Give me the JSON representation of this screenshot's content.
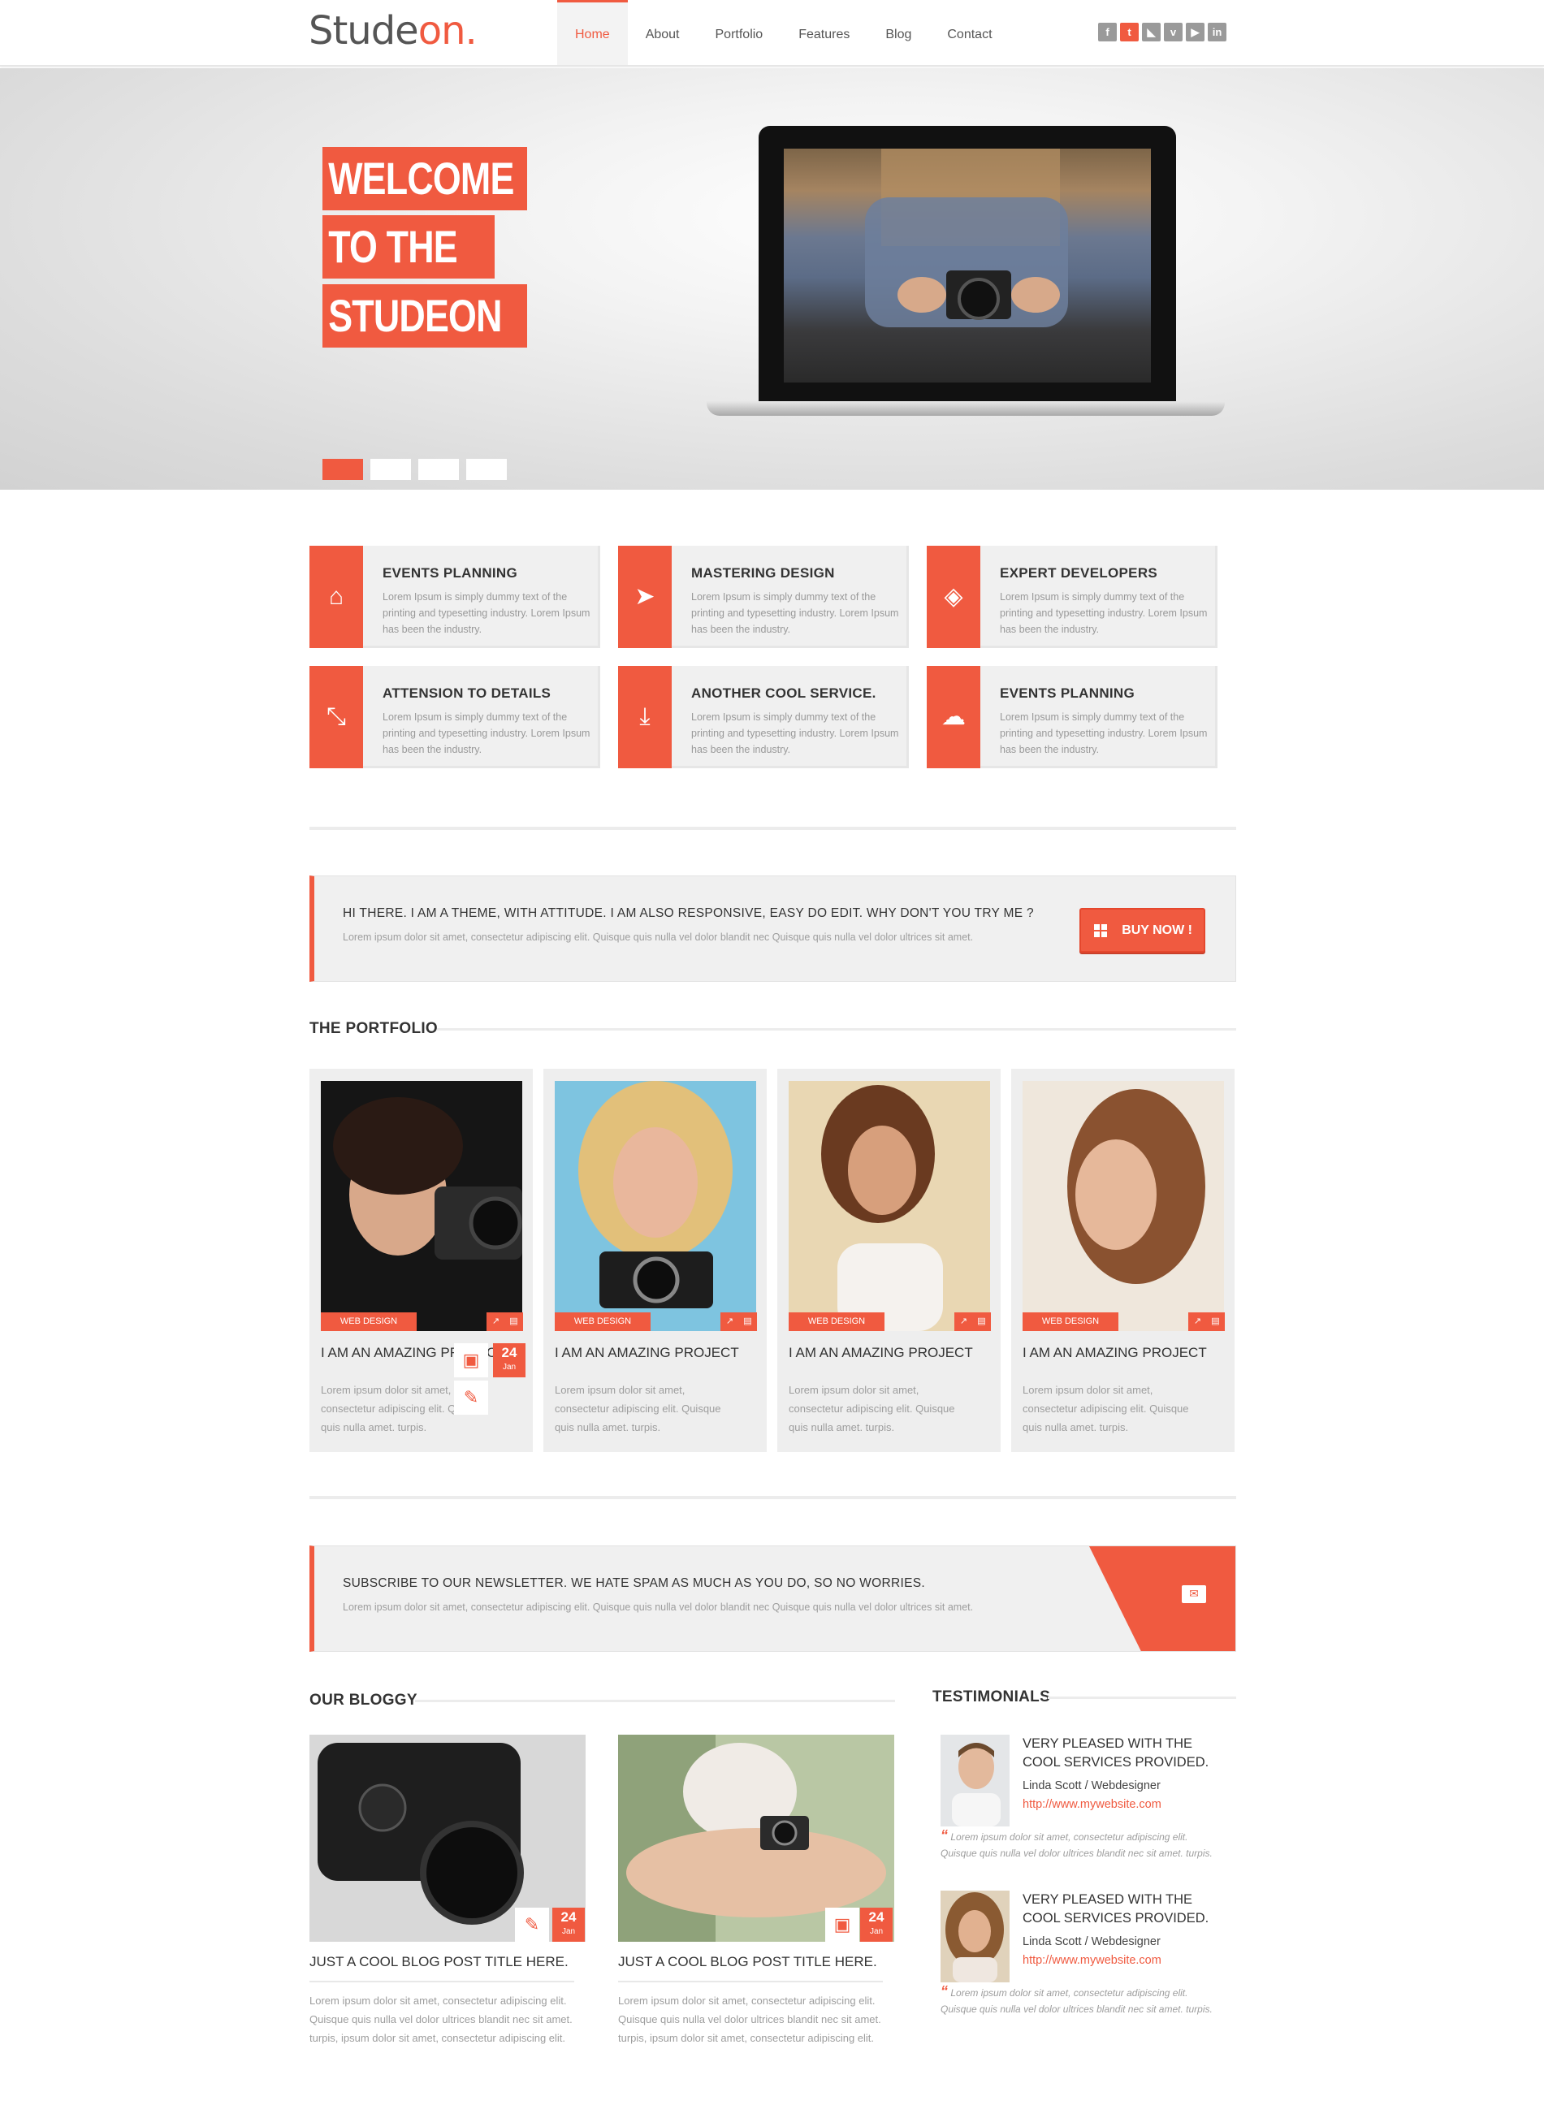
{
  "header": {
    "logo_main": "Stude",
    "logo_accent": "on.",
    "nav": [
      "Home",
      "About",
      "Portfolio",
      "Features",
      "Blog",
      "Contact"
    ],
    "social_icons": [
      "facebook-icon",
      "twitter-icon",
      "rss-icon",
      "vimeo-icon",
      "youtube-icon",
      "linkedin-icon"
    ]
  },
  "hero": {
    "lines": [
      "WELCOME",
      "TO THE",
      "STUDEON"
    ],
    "slides": 4,
    "active_slide": 1
  },
  "services": [
    {
      "title": "EVENTS PLANNING",
      "text": "Lorem Ipsum is simply dummy text of the printing and typesetting industry. Lorem Ipsum has been the industry.",
      "icon": "rocket-icon"
    },
    {
      "title": "MASTERING DESIGN",
      "text": "Lorem Ipsum is simply dummy text of the printing and typesetting industry. Lorem Ipsum has been the industry.",
      "icon": "paper-plane-icon"
    },
    {
      "title": "EXPERT DEVELOPERS",
      "text": "Lorem Ipsum is simply dummy text of the printing and typesetting industry. Lorem Ipsum has been the industry.",
      "icon": "layers-icon"
    },
    {
      "title": "ATTENSION TO DETAILS",
      "text": "Lorem Ipsum is simply dummy text of the printing and typesetting industry. Lorem Ipsum has been the industry.",
      "icon": "arrows-in-icon"
    },
    {
      "title": "ANOTHER COOL SERVICE.",
      "text": "Lorem Ipsum is simply dummy text of the printing and typesetting industry. Lorem Ipsum has been the industry.",
      "icon": "download-icon"
    },
    {
      "title": "EVENTS PLANNING",
      "text": "Lorem Ipsum is simply dummy text of the printing and typesetting industry. Lorem Ipsum has been the industry.",
      "icon": "cloud-icon"
    }
  ],
  "callout": {
    "title": "HI THERE. I AM A THEME, WITH ATTITUDE. I AM ALSO RESPONSIVE, EASY DO EDIT. WHY DON'T YOU TRY ME ?",
    "text": "Lorem ipsum dolor sit amet, consectetur adipiscing elit. Quisque quis nulla vel dolor blandit nec Quisque quis nulla vel dolor ultrices sit amet.",
    "button": "BUY NOW !"
  },
  "portfolio": {
    "title": "THE PORTFOLIO",
    "items": [
      {
        "tag": "WEB DESIGN",
        "title": "I AM AN AMAZING PROJECT",
        "text": "Lorem ipsum dolor sit amet, consectetur adipiscing elit. Quisque quis nulla amet. turpis."
      },
      {
        "tag": "WEB DESIGN",
        "title": "I AM AN AMAZING PROJECT",
        "text": "Lorem ipsum dolor sit amet, consectetur adipiscing elit. Quisque quis nulla amet. turpis."
      },
      {
        "tag": "WEB DESIGN",
        "title": "I AM AN AMAZING PROJECT",
        "text": "Lorem ipsum dolor sit amet, consectetur adipiscing elit. Quisque quis nulla amet. turpis."
      },
      {
        "tag": "WEB DESIGN",
        "title": "I AM AN AMAZING PROJECT",
        "text": "Lorem ipsum dolor sit amet, consectetur adipiscing elit. Quisque quis nulla amet. turpis."
      }
    ],
    "overlay_date_day": "24",
    "overlay_date_month": "Jan"
  },
  "newsletter": {
    "title": "SUBSCRIBE TO OUR NEWSLETTER. WE HATE SPAM AS MUCH AS YOU DO, SO NO WORRIES.",
    "text": "Lorem ipsum dolor sit amet, consectetur adipiscing elit. Quisque quis nulla vel dolor blandit nec Quisque quis nulla vel dolor ultrices sit amet."
  },
  "blog": {
    "title": "OUR BLOGGY",
    "posts": [
      {
        "day": "24",
        "month": "Jan",
        "title": "JUST A COOL BLOG POST TITLE HERE.",
        "text": "Lorem ipsum dolor sit amet, consectetur adipiscing elit. Quisque quis nulla vel dolor ultrices blandit nec sit amet. turpis, ipsum dolor sit amet, consectetur adipiscing elit.",
        "icon": "pencil-icon"
      },
      {
        "day": "24",
        "month": "Jan",
        "title": "JUST A COOL BLOG POST TITLE HERE.",
        "text": "Lorem ipsum dolor sit amet, consectetur adipiscing elit. Quisque quis nulla vel dolor ultrices blandit nec sit amet. turpis, ipsum dolor sit amet, consectetur adipiscing elit.",
        "icon": "camera-icon"
      }
    ]
  },
  "testimonials": {
    "title": "TESTIMONIALS",
    "items": [
      {
        "heading1": "VERY PLEASED WITH THE",
        "heading2": "COOL SERVICES PROVIDED.",
        "name": "Linda Scott / Webdesigner",
        "url": "http://www.mywebsite.com",
        "quote": "Lorem ipsum dolor sit amet, consectetur adipiscing elit. Quisque quis nulla vel dolor ultrices blandit nec sit amet. turpis."
      },
      {
        "heading1": "VERY PLEASED WITH THE",
        "heading2": "COOL SERVICES PROVIDED.",
        "name": "Linda Scott / Webdesigner",
        "url": "http://www.mywebsite.com",
        "quote": "Lorem ipsum dolor sit amet, consectetur adipiscing elit. Quisque quis nulla vel dolor ultrices blandit nec sit amet. turpis."
      }
    ]
  },
  "colors": {
    "accent": "#f05a40",
    "panel": "#f0f0f0",
    "text": "#333333",
    "muted": "#9d9d9d"
  }
}
